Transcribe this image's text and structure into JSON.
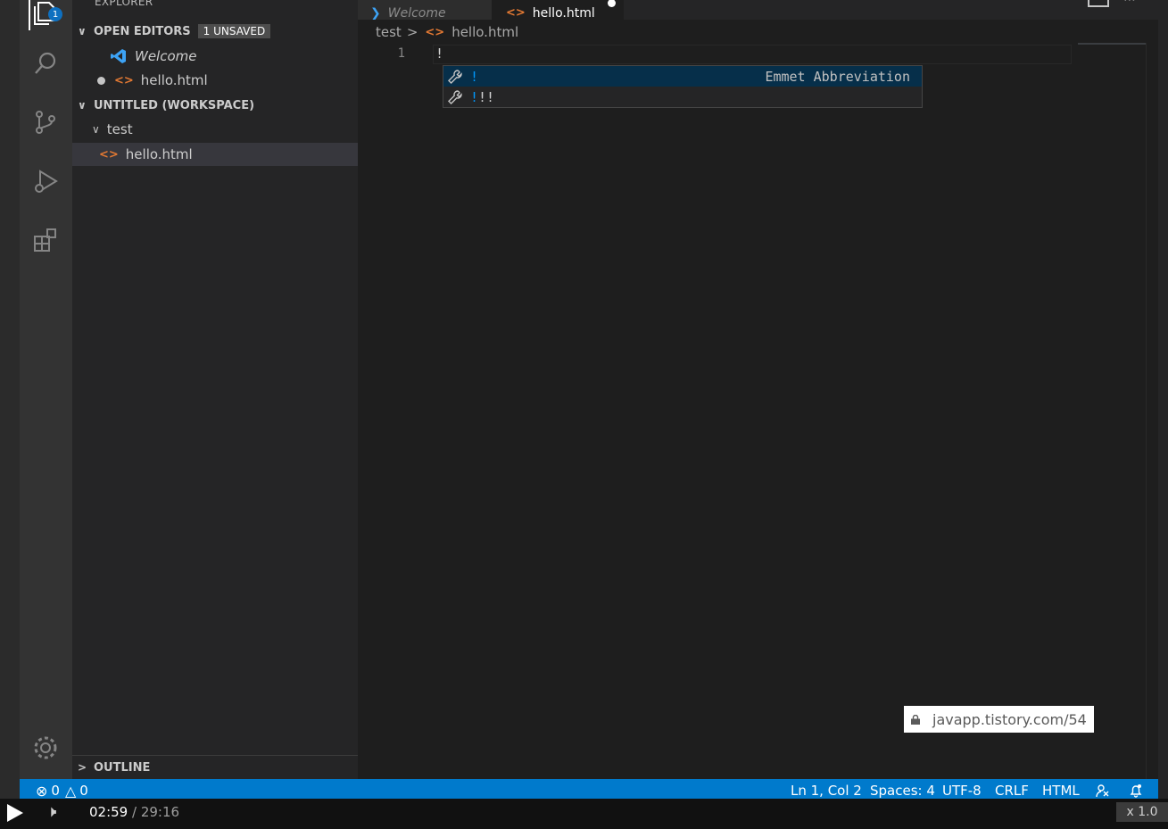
{
  "sidebar": {
    "title": "EXPLORER",
    "open_editors": {
      "label": "OPEN EDITORS",
      "badge": "1 UNSAVED",
      "items": [
        {
          "label": "Welcome"
        },
        {
          "label": "hello.html"
        }
      ]
    },
    "workspace": {
      "label": "UNTITLED (WORKSPACE)",
      "folder": "test",
      "file": "hello.html"
    },
    "outline_label": "OUTLINE"
  },
  "activity": {
    "explorer_badge": "1",
    "icons": [
      "files-icon",
      "search-icon",
      "source-control-icon",
      "run-debug-icon",
      "extensions-icon",
      "gear-icon"
    ]
  },
  "tabs": [
    {
      "label": "Welcome",
      "active": false
    },
    {
      "label": "hello.html",
      "active": true,
      "dirty": true
    }
  ],
  "breadcrumb": {
    "folder": "test",
    "file": "hello.html"
  },
  "editor": {
    "line_number": "1",
    "content": "!"
  },
  "suggest": {
    "items": [
      {
        "match": "!",
        "rest": "",
        "detail": "Emmet Abbreviation"
      },
      {
        "match": "!",
        "rest": "!!",
        "detail": ""
      }
    ]
  },
  "watermark": "javapp.tistory.com/54",
  "statusbar": {
    "errors": "0",
    "warnings": "0",
    "position": "Ln 1, Col 2",
    "spaces": "Spaces: 4",
    "encoding": "UTF-8",
    "eol": "CRLF",
    "language": "HTML"
  },
  "player": {
    "current": "02:59",
    "total": "/ 29:16",
    "speed": "x 1.0"
  },
  "colors": {
    "accent": "#007acc",
    "html_icon": "#e37933",
    "match_highlight": "#0097fb"
  }
}
